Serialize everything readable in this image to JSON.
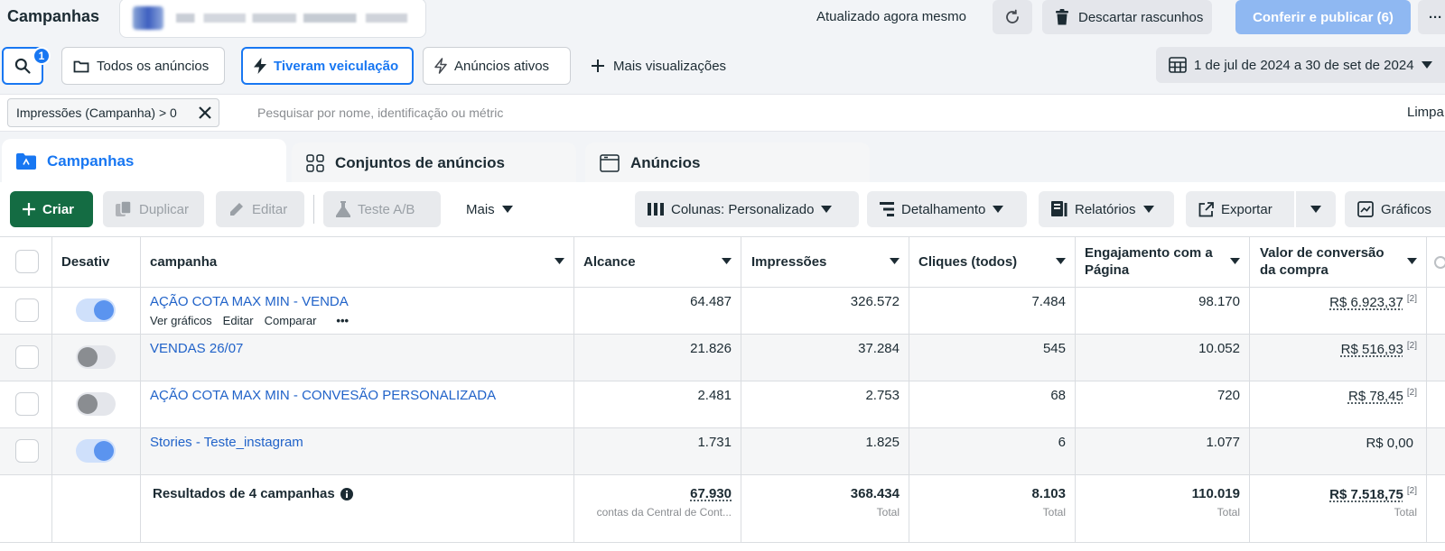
{
  "topbar": {
    "title": "Campanhas",
    "updated": "Atualizado agora mesmo",
    "discard_label": "Descartar rascunhos",
    "publish_label": "Conferir e publicar (6)",
    "more_label": "···"
  },
  "filters": {
    "badge_count": "1",
    "views": [
      "Todos os anúncios",
      "Tiveram veiculação",
      "Anúncios ativos"
    ],
    "more_views": "Mais visualizações",
    "date_range": "1 de jul de 2024 a 30 de set de 2024"
  },
  "search": {
    "chip_label": "Impressões (Campanha) > 0",
    "placeholder": "Pesquisar por nome, identificação ou métric",
    "clear": "Limpa"
  },
  "tabs": [
    "Campanhas",
    "Conjuntos de anúncios",
    "Anúncios"
  ],
  "toolbar": {
    "create": "Criar",
    "duplicate": "Duplicar",
    "edit": "Editar",
    "ab_test": "Teste A/B",
    "more": "Mais",
    "columns": "Colunas: Personalizado",
    "breakdown": "Detalhamento",
    "reports": "Relatórios",
    "export": "Exportar",
    "charts": "Gráficos"
  },
  "table": {
    "headers": {
      "toggle": "Desativ",
      "campaign": "campanha",
      "reach": "Alcance",
      "impressions": "Impressões",
      "clicks": "Cliques (todos)",
      "engagement_l1": "Engajamento com a",
      "engagement_l2": "Página",
      "conversion_l1": "Valor de conversão",
      "conversion_l2": "da compra"
    },
    "row_actions": [
      "Ver gráficos",
      "Editar",
      "Comparar",
      "•••"
    ],
    "rows": [
      {
        "name": "AÇÃO COTA MAX MIN - VENDA",
        "active": true,
        "reach": "64.487",
        "impressions": "326.572",
        "clicks": "7.484",
        "engagement": "98.170",
        "conversion": "R$ 6.923,37",
        "conv_note": "[2]"
      },
      {
        "name": "VENDAS 26/07",
        "active": false,
        "reach": "21.826",
        "impressions": "37.284",
        "clicks": "545",
        "engagement": "10.052",
        "conversion": "R$ 516,93",
        "conv_note": "[2]"
      },
      {
        "name": "AÇÃO COTA MAX MIN - CONVESÃO PERSONALIZADA",
        "active": false,
        "reach": "2.481",
        "impressions": "2.753",
        "clicks": "68",
        "engagement": "720",
        "conversion": "R$ 78,45",
        "conv_note": "[2]"
      },
      {
        "name": "Stories - Teste_instagram",
        "active": true,
        "reach": "1.731",
        "impressions": "1.825",
        "clicks": "6",
        "engagement": "1.077",
        "conversion": "R$ 0,00",
        "conv_note": ""
      }
    ],
    "footer": {
      "label": "Resultados de 4 campanhas",
      "reach": "67.930",
      "reach_sub": "contas da Central de Cont...",
      "impressions": "368.434",
      "clicks": "8.103",
      "engagement": "110.019",
      "conversion": "R$ 7.518,75",
      "conv_note": "[2]",
      "total": "Total"
    }
  }
}
